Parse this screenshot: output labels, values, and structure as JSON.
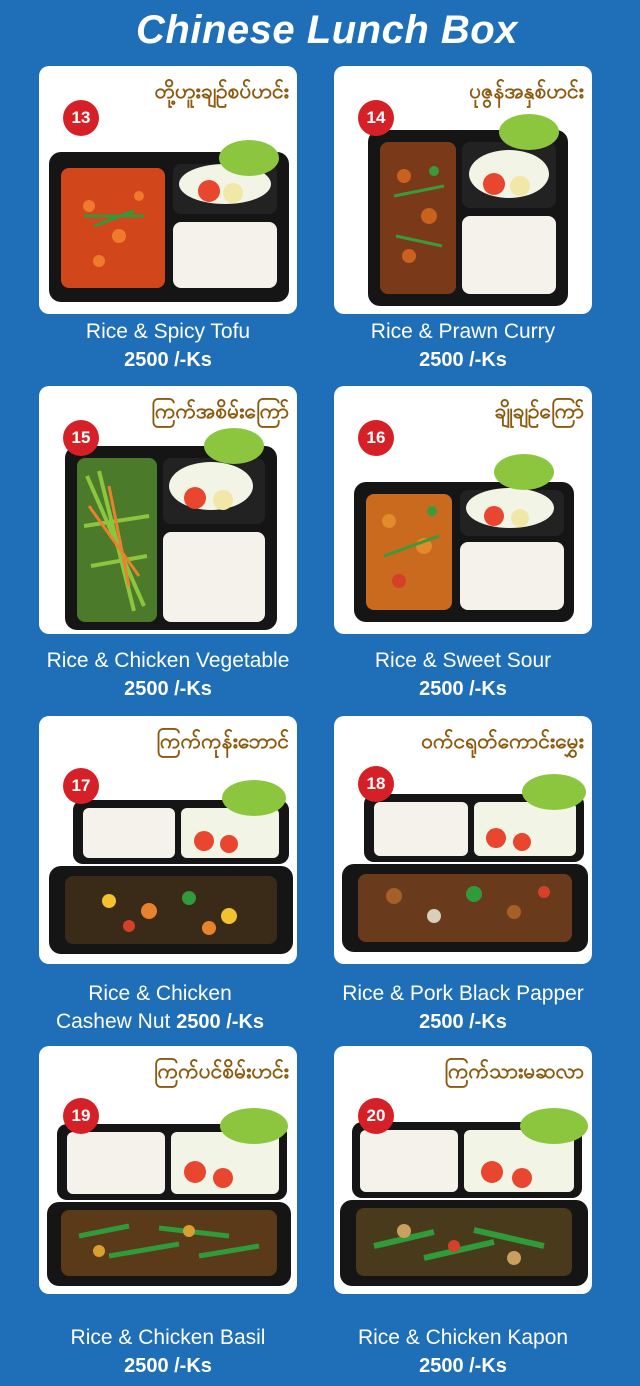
{
  "page": {
    "title": "Chinese Lunch Box"
  },
  "items": [
    {
      "number": "13",
      "myanmar": "တို့ဟူးချဥ်စပ်ဟင်း",
      "name": "Rice & Spicy Tofu",
      "price": "2500 /-Ks",
      "layout": "side"
    },
    {
      "number": "14",
      "myanmar": "ပုဇွန်အနှစ်ဟင်း",
      "name": "Rice & Prawn Curry",
      "price": "2500 /-Ks",
      "layout": "side"
    },
    {
      "number": "15",
      "myanmar": "ကြက်အစိမ်းကြော်",
      "name": "Rice & Chicken Vegetable",
      "price": "2500 /-Ks",
      "layout": "side"
    },
    {
      "number": "16",
      "myanmar": "ချိုချဥ်ကြော်",
      "name": "Rice & Sweet Sour",
      "price": "2500 /-Ks",
      "layout": "side"
    },
    {
      "number": "17",
      "myanmar": "ကြက်ကုန်းဘောင်",
      "name": "Rice & Chicken",
      "name_line2": "Cashew Nut",
      "price": "2500 /-Ks",
      "layout": "bottom"
    },
    {
      "number": "18",
      "myanmar": "ဝက်ငရုတ်ကောင်းမွှေး",
      "name": "Rice & Pork Black Papper",
      "price": "2500 /-Ks",
      "layout": "bottom"
    },
    {
      "number": "19",
      "myanmar": "ကြက်ပင်စိမ်းဟင်း",
      "name": "Rice & Chicken Basil",
      "price": "2500 /-Ks",
      "layout": "bottom"
    },
    {
      "number": "20",
      "myanmar": "ကြက်သားမဆလာ",
      "name": "Rice & Chicken Kapon",
      "price": "2500 /-Ks",
      "layout": "bottom"
    }
  ],
  "colors": {
    "background": "#1f6fb8",
    "badge": "#d62027",
    "myanmar_text": "#8b5a0f",
    "tray": "#151515",
    "rice": "#f4f2ea",
    "salad": "#8cc63f"
  }
}
